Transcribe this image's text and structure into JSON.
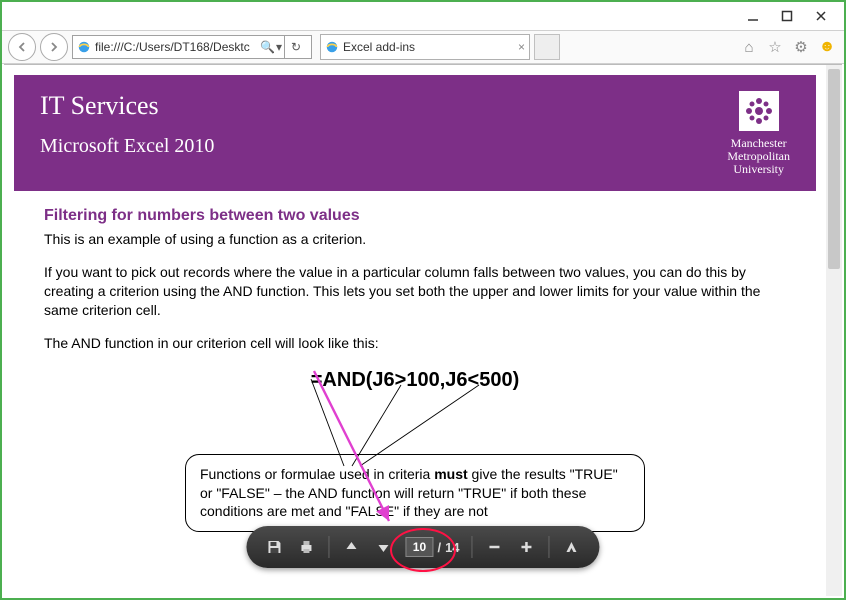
{
  "window": {
    "title": "Excel add-ins"
  },
  "address": {
    "url": "file:///C:/Users/DT168/Desktc"
  },
  "tab": {
    "title": "Excel add-ins"
  },
  "banner": {
    "brand": "IT Services",
    "subtitle": "Microsoft Excel 2010",
    "uni_line1": "Manchester",
    "uni_line2": "Metropolitan",
    "uni_line3": "University"
  },
  "doc": {
    "heading": "Filtering for numbers between two values",
    "p1": "This is an example of using a function as a criterion.",
    "p2": "If you want to pick out records where the value in a particular column falls between two values, you can do this by creating a criterion using the AND function.  This lets you set both the upper and lower limits for your value within the same criterion cell.",
    "p3": "The AND function in our criterion cell will look like this:",
    "formula": "=AND(J6>100,J6<500)",
    "callout_a": "Functions or formulae used in criteria ",
    "callout_b": "must",
    "callout_c": " give the results \"TRUE\" or \"FALSE\" – the AND function will return \"TRUE\" if both these conditions are met and \"FALSE\" if they are not"
  },
  "pdf": {
    "page": "10",
    "total": "14"
  }
}
